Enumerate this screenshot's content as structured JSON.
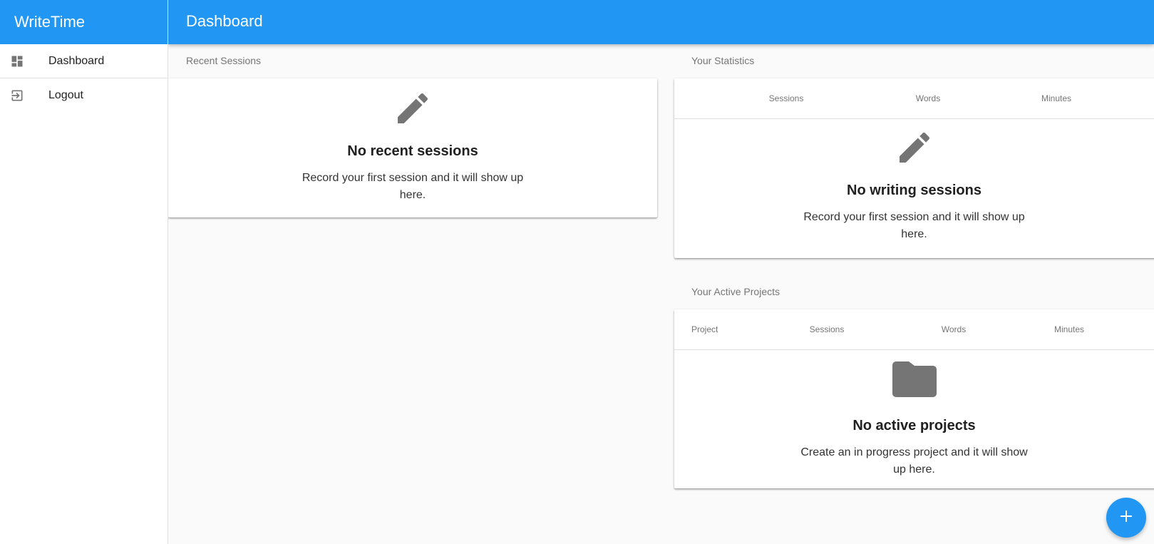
{
  "app": {
    "brand": "WriteTime",
    "page_title": "Dashboard",
    "accent_color": "#2196F3"
  },
  "sidebar": {
    "items": [
      {
        "label": "Dashboard",
        "icon": "dashboard-icon"
      },
      {
        "label": "Logout",
        "icon": "logout-icon"
      }
    ]
  },
  "recent_sessions": {
    "heading": "Recent Sessions",
    "empty": {
      "icon": "pencil-icon",
      "title": "No recent sessions",
      "description": "Record your first session and it will show up here."
    }
  },
  "statistics": {
    "heading": "Your Statistics",
    "columns": [
      "Sessions",
      "Words",
      "Minutes"
    ],
    "empty": {
      "icon": "pencil-icon",
      "title": "No writing sessions",
      "description": "Record your first session and it will show up here."
    }
  },
  "active_projects": {
    "heading": "Your Active Projects",
    "columns": [
      "Project",
      "Sessions",
      "Words",
      "Minutes"
    ],
    "empty": {
      "icon": "folder-icon",
      "title": "No active projects",
      "description": "Create an in progress project and it will show up here."
    }
  },
  "fab": {
    "icon": "plus-icon",
    "label": "+"
  }
}
